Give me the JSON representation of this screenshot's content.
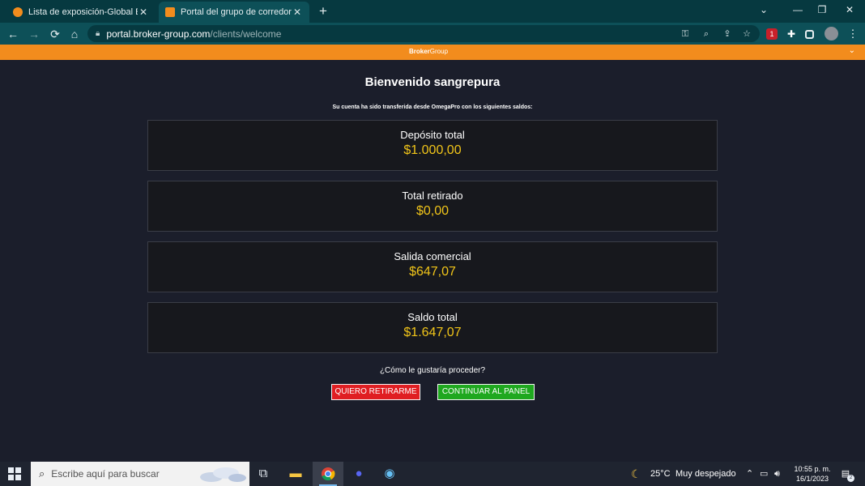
{
  "browser": {
    "tabs": [
      {
        "label": "Lista de exposición-Global Expos",
        "favicon_color": "#f28c1d",
        "active": false
      },
      {
        "label": "Portal del grupo de corredores",
        "favicon_color": "#f28c1d",
        "active": true
      }
    ],
    "new_tab_symbol": "+",
    "close_symbol": "✕",
    "url_host": "portal.broker-group.com",
    "url_path": "/clients/welcome",
    "window_controls": [
      "⌄",
      "—",
      "❐",
      "✕"
    ]
  },
  "banner": {
    "brand_bold": "Broker",
    "brand_light": "Group",
    "color": "#f28c1d"
  },
  "main": {
    "welcome": "Bienvenido sangrepura",
    "subtitle": "Su cuenta ha sido transferida desde OmegaPro con los siguientes saldos:",
    "cards": [
      {
        "label": "Depósito total",
        "value": "$1.000,00"
      },
      {
        "label": "Total retirado",
        "value": "$0,00"
      },
      {
        "label": "Salida comercial",
        "value": "$647,07"
      },
      {
        "label": "Saldo total",
        "value": "$1.647,07"
      }
    ],
    "question": "¿Cómo le gustaría proceder?",
    "withdraw_button": "QUIERO RETIRARME",
    "continue_button": "CONTINUAR AL PANEL",
    "value_color": "#f0c419"
  },
  "taskbar": {
    "search_placeholder": "Escribe aquí para buscar",
    "weather_temp": "25°C",
    "weather_desc": "Muy despejado",
    "time": "10:55 p. m.",
    "date": "16/1/2023",
    "notification_count": "2",
    "ext_badge": "1"
  }
}
